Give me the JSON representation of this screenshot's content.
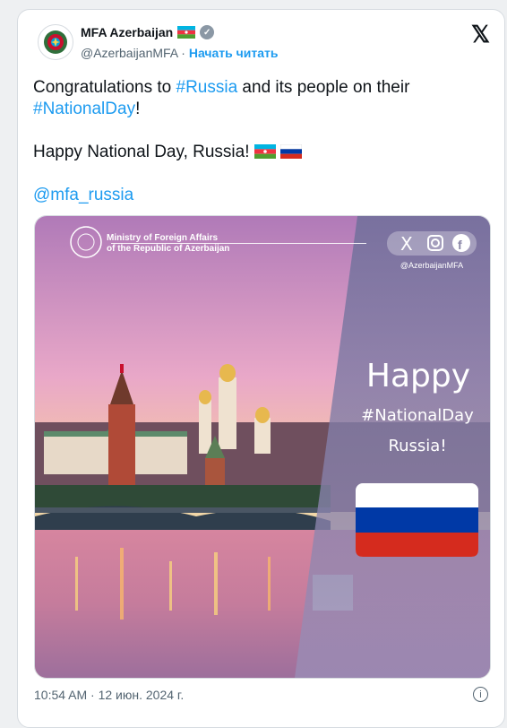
{
  "author": {
    "name": "MFA Azerbaijan",
    "handle": "@AzerbaijanMFA",
    "follow": "Начать читать"
  },
  "tweet": {
    "line1_pre": "Congratulations to ",
    "tag_russia": "#Russia",
    "line1_post": " and its people on their",
    "tag_nationalday": "#NationalDay",
    "line2_post": "!",
    "line3": "Happy National Day, Russia!",
    "mention": "@mfa_russia"
  },
  "image": {
    "ministry_line1": "Ministry of Foreign Affairs",
    "ministry_line2": "of the Republic of Azerbaijan",
    "social_handle": "@AzerbaijanMFA",
    "happy": "Happy",
    "hashtag": "#NationalDay",
    "country": "Russia!"
  },
  "timestamp": "10:54 AM · 12 июн. 2024 г.",
  "colors": {
    "link": "#1d9bf0",
    "az_blue": "#00b5e2",
    "az_red": "#ef3340",
    "az_green": "#509e2f",
    "ru_white": "#ffffff",
    "ru_blue": "#0039a6",
    "ru_red": "#d52b1e"
  }
}
